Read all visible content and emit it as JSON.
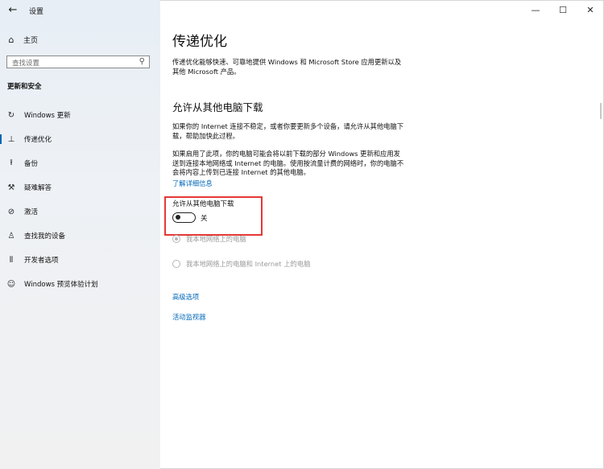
{
  "window": {
    "title": "设置",
    "controls": {
      "minimize": "—",
      "maximize": "☐",
      "close": "✕"
    }
  },
  "sidebar": {
    "home": "主页",
    "search_placeholder": "查找设置",
    "section": "更新和安全",
    "items": [
      {
        "label": "Windows 更新",
        "icon": "refresh-icon",
        "glyph": "↻"
      },
      {
        "label": "传递优化",
        "icon": "delivery-optimization-icon",
        "glyph": "⊥"
      },
      {
        "label": "备份",
        "icon": "backup-icon",
        "glyph": "⭱"
      },
      {
        "label": "疑难解答",
        "icon": "wrench-icon",
        "glyph": "🔧"
      },
      {
        "label": "激活",
        "icon": "activation-check-icon",
        "glyph": "✓"
      },
      {
        "label": "查找我的设备",
        "icon": "find-device-icon",
        "glyph": "⚲"
      },
      {
        "label": "开发者选项",
        "icon": "developer-icon",
        "glyph": "⫴"
      },
      {
        "label": "Windows 预览体验计划",
        "icon": "insider-icon",
        "glyph": "☺"
      }
    ],
    "active_index": 1
  },
  "main": {
    "title": "传递优化",
    "intro": "传递优化能够快速、可靠地提供 Windows 和 Microsoft Store 应用更新以及其他 Microsoft 产品。",
    "section_title": "允许从其他电脑下载",
    "para1": "如果你的 Internet 连接不稳定，或者你要更新多个设备，请允许从其他电脑下载，帮助加快此过程。",
    "para2": "如果启用了此项，你的电脑可能会将以前下载的部分 Windows 更新和应用发送到连接本地网络或 Internet 的电脑。使用按流量计费的网络时，你的电脑不会将内容上传到已连接 Internet 的其他电脑。",
    "learn_more": "了解详细信息",
    "toggle_label": "允许从其他电脑下载",
    "toggle_state": "关",
    "toggle_on": false,
    "radio1": "我本地网络上的电脑",
    "radio2": "我本地网络上的电脑和 Internet 上的电脑",
    "advanced": "高级选项",
    "activity": "活动监视器"
  },
  "colors": {
    "accent": "#0067b8",
    "highlight": "#e53935"
  }
}
